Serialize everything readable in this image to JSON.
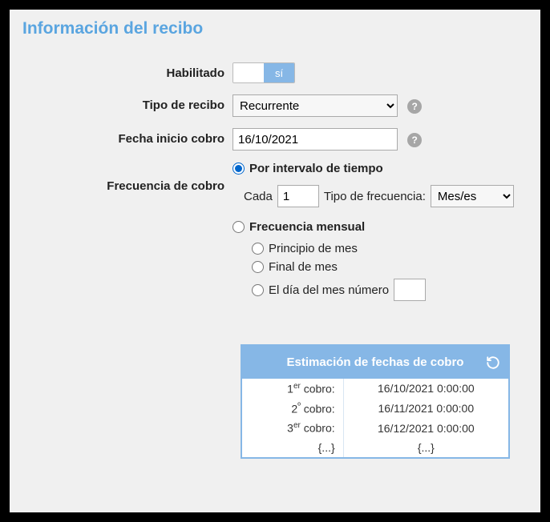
{
  "title": "Información del recibo",
  "labels": {
    "habilitado": "Habilitado",
    "tipo_recibo": "Tipo de recibo",
    "fecha_inicio": "Fecha inicio cobro",
    "frecuencia": "Frecuencia de cobro"
  },
  "toggle": {
    "on_text": "sí"
  },
  "tipo_recibo": {
    "value": "Recurrente"
  },
  "fecha_inicio": {
    "value": "16/10/2021"
  },
  "frecuencia": {
    "opt_interval": "Por intervalo de tiempo",
    "opt_monthly": "Frecuencia mensual",
    "cada_label": "Cada",
    "cada_value": "1",
    "tipo_freq_label": "Tipo de frecuencia:",
    "tipo_freq_value": "Mes/es",
    "monthly_opts": {
      "principio": "Principio de mes",
      "final": "Final de mes",
      "dia_num": "El día del mes número",
      "dia_num_value": ""
    }
  },
  "estimate": {
    "header": "Estimación de fechas de cobro",
    "rows": [
      {
        "ord_num": "1",
        "ord_sup": "er",
        "ord_suffix": " cobro:",
        "date": "16/10/2021 0:00:00"
      },
      {
        "ord_num": "2",
        "ord_sup": "º",
        "ord_suffix": " cobro:",
        "date": "16/11/2021 0:00:00"
      },
      {
        "ord_num": "3",
        "ord_sup": "er",
        "ord_suffix": " cobro:",
        "date": "16/12/2021 0:00:00"
      },
      {
        "ord_num": "",
        "ord_sup": "",
        "ord_suffix": "{...}",
        "date": "{...}"
      }
    ]
  },
  "help_glyph": "?"
}
